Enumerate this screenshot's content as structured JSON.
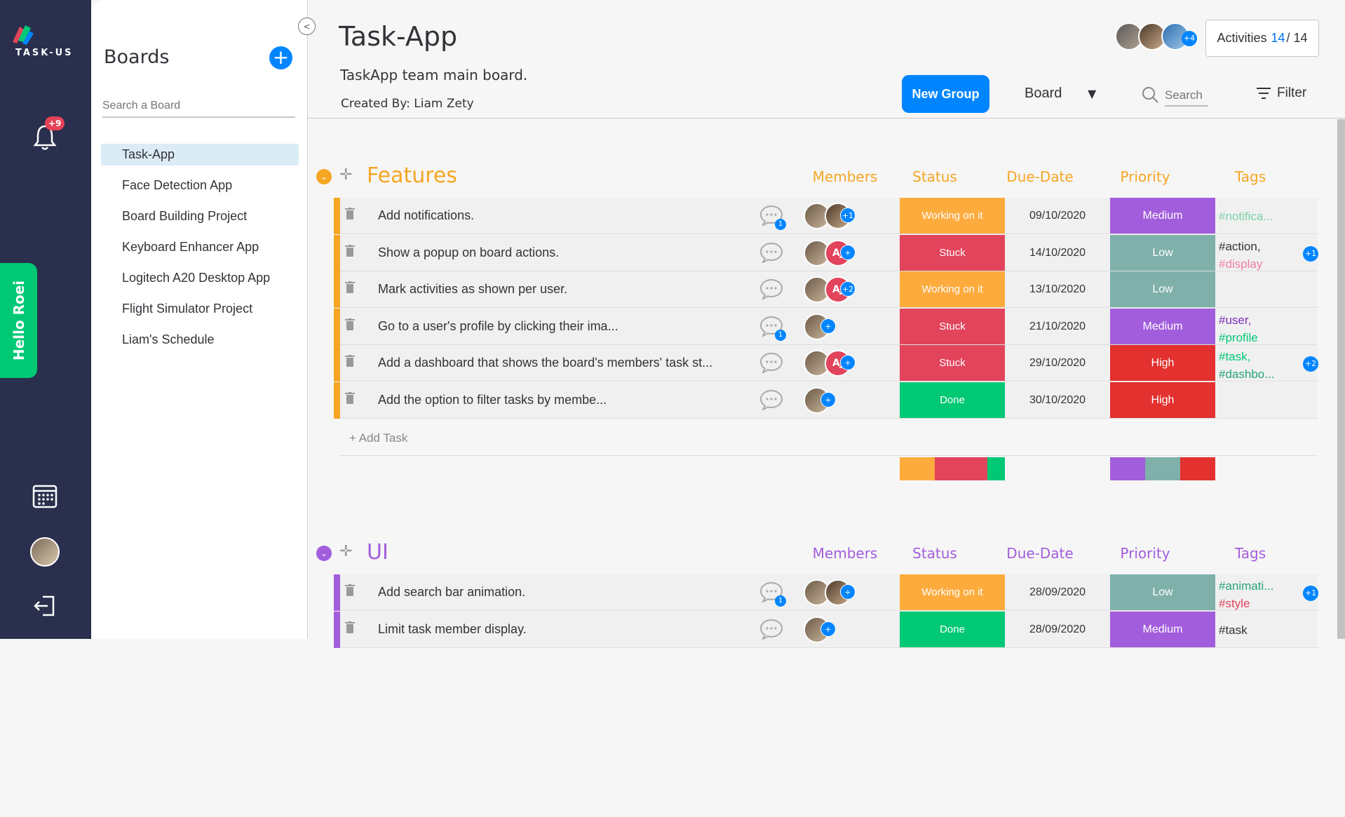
{
  "app": {
    "logo_text": "TASK-US",
    "notifications_badge": "+9",
    "greeting": "Hello Roei"
  },
  "sidebar": {
    "title": "Boards",
    "add_label": "+",
    "search_placeholder": "Search a Board",
    "boards": [
      {
        "label": "Task-App",
        "active": true
      },
      {
        "label": "Face Detection App"
      },
      {
        "label": "Board Building Project"
      },
      {
        "label": "Keyboard Enhancer App"
      },
      {
        "label": "Logitech A20 Desktop App"
      },
      {
        "label": "Flight Simulator Project"
      },
      {
        "label": "Liam's Schedule"
      }
    ]
  },
  "header": {
    "title": "Task-App",
    "description": "TaskApp team main board.",
    "created_by": "Created By: Liam Zety",
    "avatars_more": "+4",
    "activities_label": "Activities",
    "activities_count": "14",
    "activities_total": "/ 14",
    "new_group_label": "New Group",
    "view_label": "Board",
    "search_placeholder": "Search",
    "filter_label": "Filter"
  },
  "columns": {
    "members": "Members",
    "status": "Status",
    "due": "Due-Date",
    "priority": "Priority",
    "tags": "Tags"
  },
  "colors": {
    "working": "#fdab3d",
    "stuck": "#e2445c",
    "done": "#00c875",
    "medium": "#a25ddc",
    "low": "#7fb0aa",
    "high": "#e2312f",
    "features": "#f5a623",
    "ui": "#a25ddc"
  },
  "groups": [
    {
      "name": "Features",
      "add_task": "+ Add Task",
      "tasks": [
        {
          "title": "Add notifications.",
          "comments": "1",
          "members_more": "+1",
          "status": "Working on it",
          "due": "09/10/2020",
          "priority": "Medium",
          "tags": [
            "#notifica..."
          ],
          "tags_more": ""
        },
        {
          "title": "Show a popup on board actions.",
          "comments": "",
          "initials": "AJ",
          "members_more": "+",
          "status": "Stuck",
          "due": "14/10/2020",
          "priority": "Low",
          "tags": [
            "#action,",
            "#display"
          ],
          "tags_more": "+1"
        },
        {
          "title": "Mark activities as shown per user.",
          "comments": "",
          "initials": "AJ",
          "members_more": "+2",
          "status": "Working on it",
          "due": "13/10/2020",
          "priority": "Low",
          "tags": [],
          "tags_more": ""
        },
        {
          "title": "Go to a user's profile by clicking their ima...",
          "comments": "1",
          "members_more": "+",
          "status": "Stuck",
          "due": "21/10/2020",
          "priority": "Medium",
          "tags": [
            "#user,",
            "#profile"
          ],
          "tags_more": ""
        },
        {
          "title": "Add a dashboard that shows the board's members' task st...",
          "comments": "",
          "initials": "AJ",
          "members_more": "+",
          "status": "Stuck",
          "due": "29/10/2020",
          "priority": "High",
          "tags": [
            "#task,",
            "#dashbo..."
          ],
          "tags_more": "+2"
        },
        {
          "title": "Add the option to filter tasks by membe...",
          "comments": "",
          "members_more": "+",
          "status": "Done",
          "due": "30/10/2020",
          "priority": "High",
          "tags": [],
          "tags_more": ""
        }
      ],
      "status_summary": [
        {
          "status": "Working on it",
          "fraction": 0.333
        },
        {
          "status": "Stuck",
          "fraction": 0.5
        },
        {
          "status": "Done",
          "fraction": 0.167
        }
      ],
      "priority_summary": [
        {
          "priority": "Medium",
          "fraction": 0.333
        },
        {
          "priority": "Low",
          "fraction": 0.333
        },
        {
          "priority": "High",
          "fraction": 0.333
        }
      ]
    },
    {
      "name": "UI",
      "tasks": [
        {
          "title": "Add search bar animation.",
          "comments": "1",
          "members_more": "+",
          "status": "Working on it",
          "due": "28/09/2020",
          "priority": "Low",
          "tags": [
            "#animati...",
            "#style"
          ],
          "tags_more": "+1"
        },
        {
          "title": "Limit task member display.",
          "comments": "",
          "members_more": "+",
          "status": "Done",
          "due": "28/09/2020",
          "priority": "Medium",
          "tags": [
            "#task"
          ],
          "tags_more": ""
        }
      ]
    }
  ]
}
